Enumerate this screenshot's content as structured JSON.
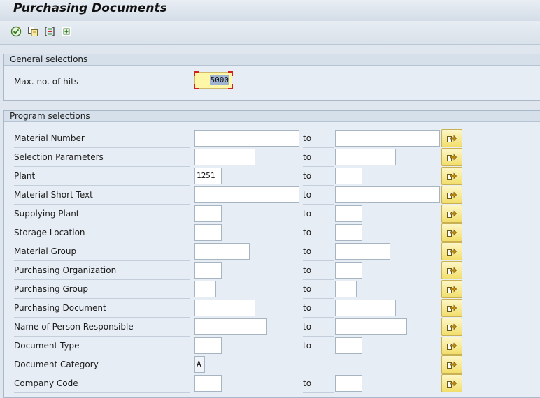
{
  "title": "Purchasing Documents",
  "toolbar": {
    "icons": [
      "execute-icon",
      "copy-variant-icon",
      "selection-options-icon",
      "dynamic-selections-icon"
    ]
  },
  "general": {
    "heading": "General selections",
    "max_hits_label": "Max. no. of hits",
    "max_hits_value": "5000"
  },
  "program": {
    "heading": "Program selections",
    "to_label": "to",
    "rows": [
      {
        "label": "Material Number",
        "from": "",
        "to": ""
      },
      {
        "label": "Selection Parameters",
        "from": "",
        "to": ""
      },
      {
        "label": "Plant",
        "from": "1251",
        "to": ""
      },
      {
        "label": "Material Short Text",
        "from": "",
        "to": ""
      },
      {
        "label": "Supplying Plant",
        "from": "",
        "to": ""
      },
      {
        "label": "Storage Location",
        "from": "",
        "to": ""
      },
      {
        "label": "Material Group",
        "from": "",
        "to": ""
      },
      {
        "label": "Purchasing Organization",
        "from": "",
        "to": ""
      },
      {
        "label": "Purchasing Group",
        "from": "",
        "to": ""
      },
      {
        "label": "Purchasing Document",
        "from": "",
        "to": ""
      },
      {
        "label": "Name of Person Responsible",
        "from": "",
        "to": ""
      },
      {
        "label": "Document Type",
        "from": "",
        "to": ""
      },
      {
        "label": "Document Category",
        "from": "A"
      },
      {
        "label": "Company Code",
        "from": "",
        "to": ""
      }
    ]
  },
  "colors": {
    "background": "#dfe6ee",
    "highlight_field": "#fff7a8",
    "multi_button": "#f2de6a"
  }
}
